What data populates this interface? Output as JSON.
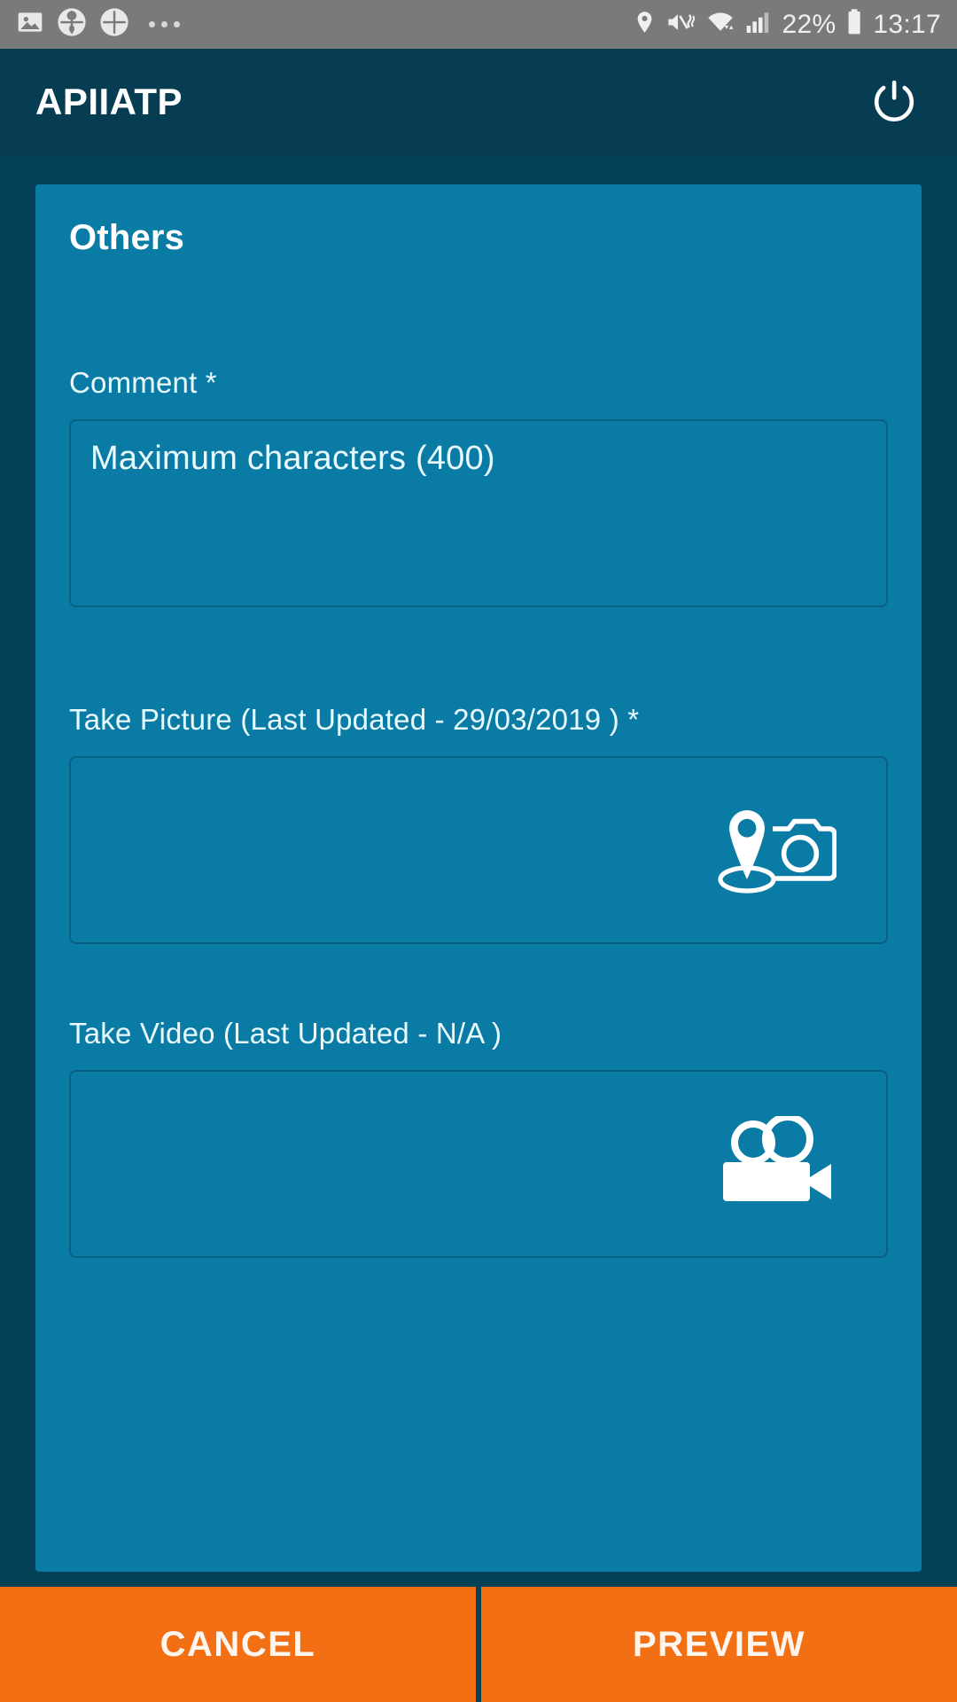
{
  "statusbar": {
    "left_icons": [
      "photo-icon",
      "flower-badge-icon",
      "flower-badge-icon",
      "more-dots-icon"
    ],
    "right_icons": [
      "location-pin-icon",
      "volume-mute-vibrate-icon",
      "wifi-icon",
      "signal-bars-icon",
      "battery-icon"
    ],
    "battery_percent": "22%",
    "time": "13:17"
  },
  "appbar": {
    "title": "APIIATP",
    "power_icon": "power-icon"
  },
  "card": {
    "title": "Others",
    "comment": {
      "label": "Comment *",
      "placeholder": "Maximum characters (400)",
      "value": ""
    },
    "take_picture": {
      "label": "Take Picture (Last Updated - 29/03/2019 ) *",
      "icon": "geo-camera-icon"
    },
    "take_video": {
      "label": "Take Video (Last Updated - N/A )",
      "icon": "video-camera-icon"
    }
  },
  "actions": {
    "cancel_label": "CANCEL",
    "preview_label": "PREVIEW"
  },
  "colors": {
    "page_background": "#054258",
    "appbar": "#073d53",
    "card": "#0a7ba5",
    "accent_orange": "#f26f14",
    "statusbar": "#7a7a7a",
    "field_border": "#0a5f80"
  }
}
